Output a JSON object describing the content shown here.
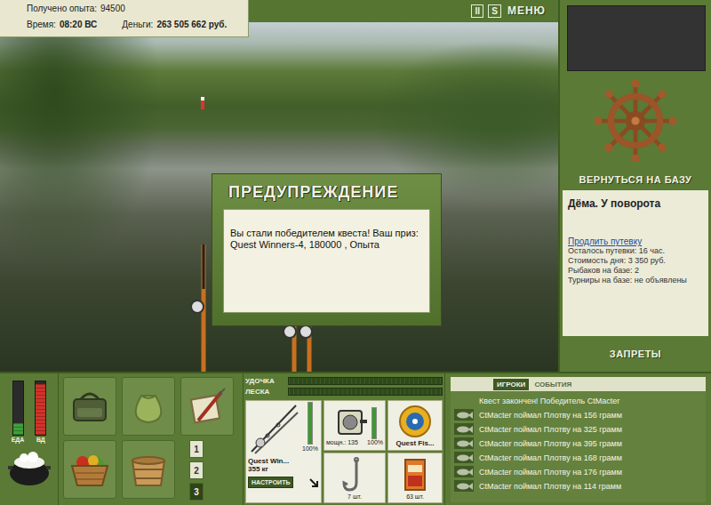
{
  "stats": {
    "experience_label": "Получено опыта:",
    "experience": "94500",
    "time_label": "Время:",
    "time": "08:20 ВС",
    "money_label": "Деньги:",
    "money": "263 505 662 руб."
  },
  "toolbar": [
    {
      "label": "II"
    },
    {
      "label": "S"
    },
    {
      "label": "МЕНЮ"
    }
  ],
  "dialog": {
    "title": "ПРЕДУПРЕЖДЕНИЕ",
    "message": "Вы стали победителем квеста! Ваш приз: Quest Winners-4, 180000 , Опыта"
  },
  "side": {
    "return_button": "ВЕРНУТЬСЯ НА БАЗУ",
    "location": "Дёма. У поворота",
    "extend_link": "Продлить путевку",
    "info": [
      "Осталось путевки: 16 час.",
      "Стоимость дня: 3 350 руб.",
      "Рыбаков на базе: 2",
      "Турниры на базе: не объявлены"
    ],
    "bans_button": "ЗАПРЕТЫ"
  },
  "meters": [
    {
      "label": "ЕДА",
      "level": 0.22,
      "color": "#3ea13a"
    },
    {
      "label": "ВД",
      "level": 0.95,
      "color": "#d0332b"
    }
  ],
  "slots": [
    {
      "label": "1",
      "selected": false
    },
    {
      "label": "2",
      "selected": false
    },
    {
      "label": "3",
      "selected": true
    }
  ],
  "tackle_bars": [
    {
      "label": "УДОЧКА",
      "level": 0
    },
    {
      "label": "ЛЕСКА",
      "level": 0
    }
  ],
  "tackle": {
    "rod": {
      "name": "Quest Win...",
      "strength": "355 кг",
      "level": 1,
      "reading": "100%",
      "button": "НАСТРОИТЬ"
    },
    "reel": {
      "text": "мощн.: 135",
      "level": 1,
      "reading": "100%"
    },
    "line": {
      "text": "Quest Fis..."
    },
    "hook": {
      "count": "7 шт."
    },
    "bait": {
      "count": "63 шт."
    }
  },
  "events_tabs": [
    {
      "label": "ИГРОКИ",
      "selected": true
    },
    {
      "label": "СОБЫТИЯ",
      "selected": false
    }
  ],
  "events": [
    {
      "text": "Квест закончен! Победитель CtMacter",
      "kind": "notice"
    },
    {
      "text": "CtMacter поймал Плотву на 156 грамм",
      "kind": "catch"
    },
    {
      "text": "CtMacter поймал Плотву на 325 грамм",
      "kind": "catch"
    },
    {
      "text": "CtMacter поймал Плотву на 395 грамм",
      "kind": "catch"
    },
    {
      "text": "CtMacter поймал Плотву на 168 грамм",
      "kind": "catch"
    },
    {
      "text": "CtMacter поймал Плотву на 176 грамм",
      "kind": "catch"
    },
    {
      "text": "CtMacter поймал Плотву на 114 грамм",
      "kind": "catch"
    }
  ]
}
